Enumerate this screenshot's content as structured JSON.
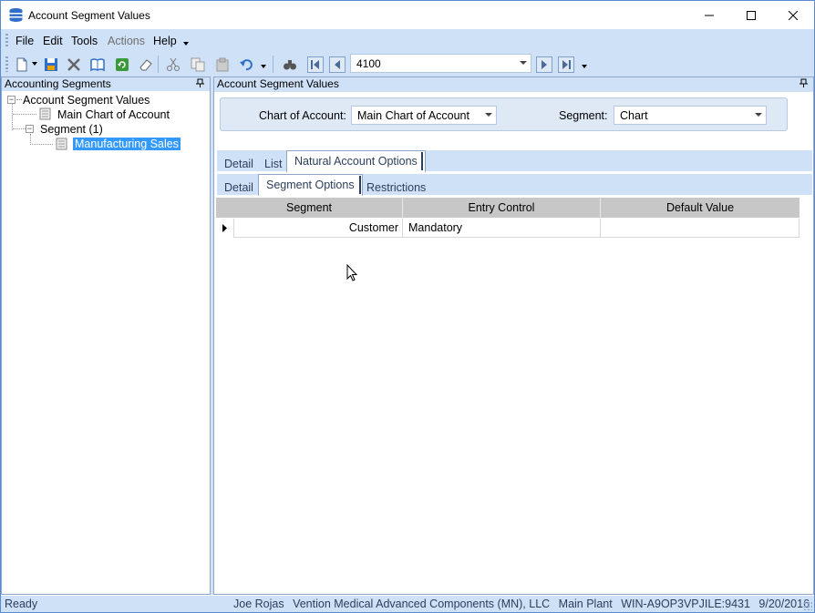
{
  "window": {
    "title": "Account Segment Values",
    "minimize_icon": "minimize-icon",
    "maximize_icon": "maximize-icon",
    "close_icon": "close-icon"
  },
  "menu": {
    "items": [
      {
        "label": "File",
        "enabled": true
      },
      {
        "label": "Edit",
        "enabled": true
      },
      {
        "label": "Tools",
        "enabled": true
      },
      {
        "label": "Actions",
        "enabled": false
      },
      {
        "label": "Help",
        "enabled": true
      }
    ]
  },
  "toolbar": {
    "icons": [
      "new-icon",
      "save-icon",
      "delete-icon",
      "book-icon",
      "refresh-icon",
      "eraser-icon",
      "cut-icon",
      "copy-icon",
      "paste-icon",
      "undo-icon",
      "find-icon",
      "first-record-icon",
      "previous-record-icon",
      "next-record-icon",
      "last-record-icon"
    ],
    "record_value": "4100"
  },
  "left_panel": {
    "header": "Accounting Segments",
    "tree": {
      "root": "Account Segment Values",
      "chart": "Main Chart of Account",
      "segment": "Segment (1)",
      "value": "Manufacturing Sales"
    }
  },
  "right_panel": {
    "header": "Account Segment Values",
    "chart_label": "Chart of Account:",
    "chart_value": "Main Chart of Account",
    "segment_label": "Segment:",
    "segment_value": "Chart",
    "outer_tabs": [
      "Detail",
      "List",
      "Natural Account Options"
    ],
    "inner_tabs": [
      "Detail",
      "Segment Options",
      "Restrictions"
    ],
    "grid": {
      "columns": [
        "Segment",
        "Entry Control",
        "Default Value"
      ],
      "rows": [
        {
          "segment": "Customer",
          "entry_control": "Mandatory",
          "default_value": ""
        }
      ]
    }
  },
  "status": {
    "ready": "Ready",
    "user": "Joe Rojas",
    "company": "Vention Medical Advanced Components (MN), LLC",
    "plant": "Main Plant",
    "server": "WIN-A9OP3VPJILE:9431",
    "date": "9/20/2016"
  },
  "colors": {
    "chrome": "#cfe1f7",
    "selection": "#3399ff",
    "grid_header": "#c7c7c7"
  }
}
